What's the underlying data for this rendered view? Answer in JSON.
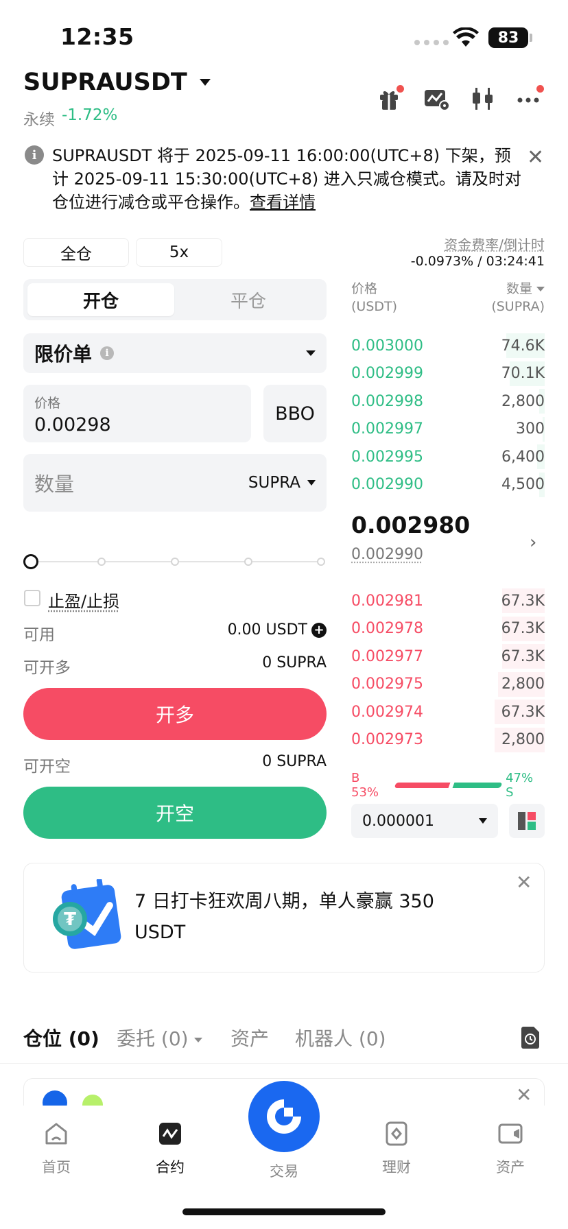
{
  "status": {
    "time": "12:35",
    "battery": "83"
  },
  "header": {
    "symbol": "SUPRAUSDT",
    "type": "永续",
    "change": "-1.72%"
  },
  "notice": {
    "text": "SUPRAUSDT 将于 2025-09-11 16:00:00(UTC+8) 下架，预计 2025-09-11 15:30:00(UTC+8) 进入只减仓模式。请及时对仓位进行减仓或平仓操作。",
    "link": "查看详情"
  },
  "margin": {
    "mode": "全仓",
    "leverage": "5x"
  },
  "funding": {
    "label": "资金费率/倒计时",
    "value": "-0.0973% / 03:24:41"
  },
  "tabs": {
    "open": "开仓",
    "close": "平仓"
  },
  "order": {
    "type": "限价单",
    "price_label": "价格",
    "price_value": "0.00298",
    "bbo": "BBO",
    "qty_placeholder": "数量",
    "qty_unit": "SUPRA"
  },
  "slider": {
    "value": 0
  },
  "tpsl": {
    "label": "止盈/止损"
  },
  "account": {
    "available_label": "可用",
    "available_value": "0.00 USDT",
    "max_long_label": "可开多",
    "max_long_value": "0 SUPRA",
    "max_short_label": "可开空",
    "max_short_value": "0 SUPRA"
  },
  "buttons": {
    "long": "开多",
    "short": "开空"
  },
  "orderbook": {
    "price_header": "价格",
    "price_unit": "(USDT)",
    "qty_header": "数量",
    "qty_unit": "(SUPRA)",
    "asks": [
      {
        "price": "0.003000",
        "qty": "74.6K",
        "depth": 0.2
      },
      {
        "price": "0.002999",
        "qty": "70.1K",
        "depth": 0.18
      },
      {
        "price": "0.002998",
        "qty": "2,800",
        "depth": 0.03
      },
      {
        "price": "0.002997",
        "qty": "300",
        "depth": 0.01
      },
      {
        "price": "0.002995",
        "qty": "6,400",
        "depth": 0.04
      },
      {
        "price": "0.002990",
        "qty": "4,500",
        "depth": 0.03
      }
    ],
    "last_price": "0.002980",
    "mark_price": "0.002990",
    "bids": [
      {
        "price": "0.002981",
        "qty": "67.3K",
        "depth": 0.22
      },
      {
        "price": "0.002978",
        "qty": "67.3K",
        "depth": 0.22
      },
      {
        "price": "0.002977",
        "qty": "67.3K",
        "depth": 0.22
      },
      {
        "price": "0.002975",
        "qty": "2,800",
        "depth": 0.24
      },
      {
        "price": "0.002974",
        "qty": "67.3K",
        "depth": 0.26
      },
      {
        "price": "0.002973",
        "qty": "2,800",
        "depth": 0.26
      }
    ],
    "buy_ratio": "B 53%",
    "sell_ratio": "47% S",
    "buy_pct": 53,
    "sell_pct": 47,
    "precision": "0.000001"
  },
  "promo": {
    "text": "7 日打卡狂欢周八期，单人豪赢 350 USDT"
  },
  "bottom_tabs": [
    "仓位 (0)",
    "委托 (0)",
    "资产",
    "机器人 (0)"
  ],
  "nav": {
    "home": "首页",
    "contract": "合约",
    "trade": "交易",
    "earn": "理财",
    "assets": "资产"
  },
  "colors": {
    "buy": "#f64c64",
    "sell": "#2ebd85",
    "accent": "#1a68f0"
  }
}
